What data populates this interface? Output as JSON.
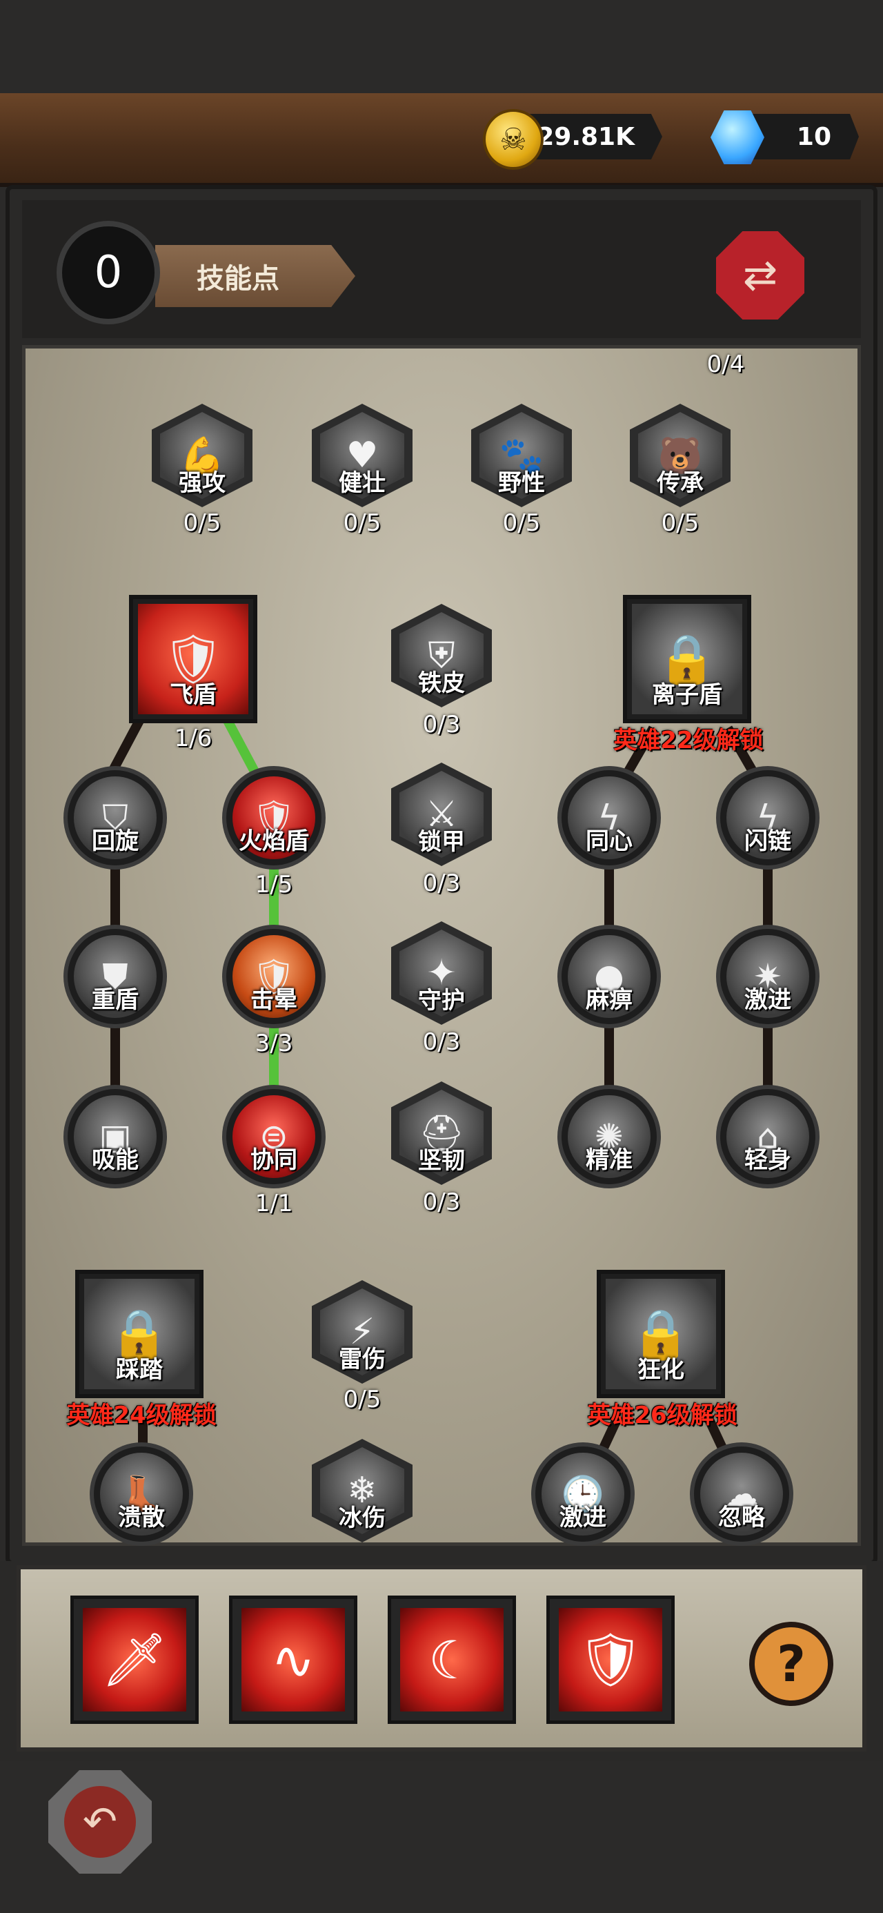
{
  "currencies": {
    "gold": {
      "icon": "skull-coin-icon",
      "value": "29.81K"
    },
    "gems": {
      "icon": "blue-gem-icon",
      "value": "10"
    }
  },
  "header": {
    "skill_points": "0",
    "skill_points_label": "技能点",
    "swap_icon": "swap-arrows-icon"
  },
  "tree": {
    "top_counter": "0/4",
    "row1": [
      {
        "label": "强攻",
        "count": "0/5",
        "icon": "flexed-arm-icon"
      },
      {
        "label": "健壮",
        "count": "0/5",
        "icon": "heart-icon"
      },
      {
        "label": "野性",
        "count": "0/5",
        "icon": "paw-icon"
      },
      {
        "label": "传承",
        "count": "0/5",
        "icon": "bear-icon"
      }
    ],
    "branch_left": {
      "root": {
        "label": "飞盾",
        "count": "1/6",
        "icon": "shield-icon"
      },
      "col1": [
        {
          "label": "回旋",
          "icon": "double-shield-icon"
        },
        {
          "label": "重盾",
          "icon": "heavy-shield-icon"
        },
        {
          "label": "吸能",
          "icon": "absorb-icon"
        }
      ],
      "col2": [
        {
          "label": "火焰盾",
          "count": "1/5",
          "icon": "fire-shield-icon"
        },
        {
          "label": "击晕",
          "count": "3/3",
          "icon": "stun-shield-icon"
        },
        {
          "label": "协同",
          "count": "1/1",
          "icon": "sync-shield-icon"
        }
      ]
    },
    "branch_middle": [
      {
        "label": "铁皮",
        "count": "0/3",
        "icon": "iron-skin-icon"
      },
      {
        "label": "锁甲",
        "count": "0/3",
        "icon": "chain-armor-icon"
      },
      {
        "label": "守护",
        "count": "0/3",
        "icon": "guard-icon"
      },
      {
        "label": "坚韧",
        "count": "0/3",
        "icon": "helmet-icon"
      }
    ],
    "branch_right": {
      "root": {
        "label": "离子盾",
        "lock_text": "英雄22级解锁",
        "icon": "lock-icon"
      },
      "col1": [
        {
          "label": "同心",
          "icon": "lightning-orb-icon"
        },
        {
          "label": "麻痹",
          "icon": "paralyze-orb-icon"
        },
        {
          "label": "精准",
          "icon": "precision-orb-icon"
        }
      ],
      "col2": [
        {
          "label": "闪链",
          "icon": "chain-lightning-icon"
        },
        {
          "label": "激进",
          "icon": "spark-orb-icon"
        },
        {
          "label": "轻身",
          "icon": "light-boot-icon"
        }
      ]
    },
    "bottom_left": {
      "root": {
        "label": "踩踏",
        "lock_text": "英雄24级解锁",
        "icon": "lock-icon"
      },
      "child": {
        "label": "溃散",
        "icon": "boot-stomp-icon"
      }
    },
    "bottom_middle": [
      {
        "label": "雷伤",
        "count": "0/5",
        "icon": "lightning-bolt-icon"
      },
      {
        "label": "冰伤",
        "icon": "snowflake-icon"
      }
    ],
    "bottom_right": {
      "root": {
        "label": "狂化",
        "lock_text": "英雄26级解锁",
        "icon": "lock-icon"
      },
      "children": [
        {
          "label": "激进",
          "icon": "clock-icon"
        },
        {
          "label": "忽略",
          "icon": "cloud-icon"
        }
      ]
    }
  },
  "active_skills": [
    {
      "icon": "sword-dash-icon"
    },
    {
      "icon": "swirl-icon"
    },
    {
      "icon": "crescent-slash-icon"
    },
    {
      "icon": "shield-icon"
    }
  ],
  "help_icon": "question-icon",
  "back_icon": "back-arrow-icon",
  "colors": {
    "accent_red": "#c7221a",
    "lock_red": "#ff2a1a",
    "path_green": "#56c23a",
    "panel": "#a8a18e"
  }
}
